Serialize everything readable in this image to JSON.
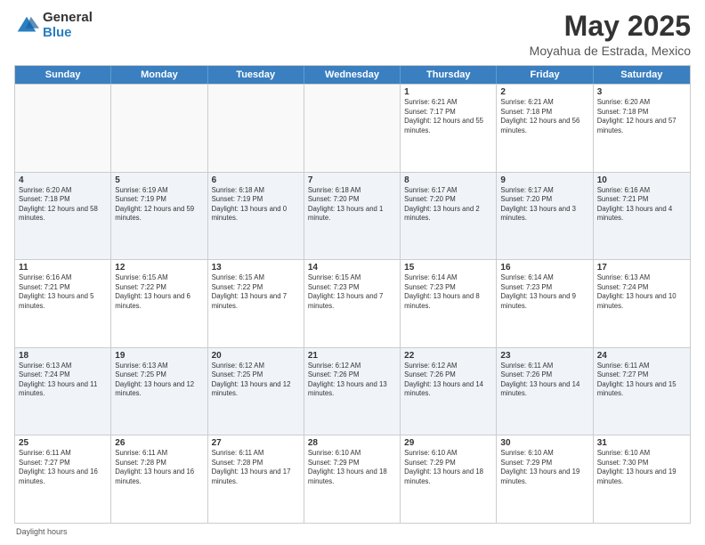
{
  "logo": {
    "general": "General",
    "blue": "Blue"
  },
  "title": "May 2025",
  "subtitle": "Moyahua de Estrada, Mexico",
  "header_days": [
    "Sunday",
    "Monday",
    "Tuesday",
    "Wednesday",
    "Thursday",
    "Friday",
    "Saturday"
  ],
  "weeks": [
    [
      {
        "day": "",
        "sunrise": "",
        "sunset": "",
        "daylight": ""
      },
      {
        "day": "",
        "sunrise": "",
        "sunset": "",
        "daylight": ""
      },
      {
        "day": "",
        "sunrise": "",
        "sunset": "",
        "daylight": ""
      },
      {
        "day": "",
        "sunrise": "",
        "sunset": "",
        "daylight": ""
      },
      {
        "day": "1",
        "sunrise": "Sunrise: 6:21 AM",
        "sunset": "Sunset: 7:17 PM",
        "daylight": "Daylight: 12 hours and 55 minutes."
      },
      {
        "day": "2",
        "sunrise": "Sunrise: 6:21 AM",
        "sunset": "Sunset: 7:18 PM",
        "daylight": "Daylight: 12 hours and 56 minutes."
      },
      {
        "day": "3",
        "sunrise": "Sunrise: 6:20 AM",
        "sunset": "Sunset: 7:18 PM",
        "daylight": "Daylight: 12 hours and 57 minutes."
      }
    ],
    [
      {
        "day": "4",
        "sunrise": "Sunrise: 6:20 AM",
        "sunset": "Sunset: 7:18 PM",
        "daylight": "Daylight: 12 hours and 58 minutes."
      },
      {
        "day": "5",
        "sunrise": "Sunrise: 6:19 AM",
        "sunset": "Sunset: 7:19 PM",
        "daylight": "Daylight: 12 hours and 59 minutes."
      },
      {
        "day": "6",
        "sunrise": "Sunrise: 6:18 AM",
        "sunset": "Sunset: 7:19 PM",
        "daylight": "Daylight: 13 hours and 0 minutes."
      },
      {
        "day": "7",
        "sunrise": "Sunrise: 6:18 AM",
        "sunset": "Sunset: 7:20 PM",
        "daylight": "Daylight: 13 hours and 1 minute."
      },
      {
        "day": "8",
        "sunrise": "Sunrise: 6:17 AM",
        "sunset": "Sunset: 7:20 PM",
        "daylight": "Daylight: 13 hours and 2 minutes."
      },
      {
        "day": "9",
        "sunrise": "Sunrise: 6:17 AM",
        "sunset": "Sunset: 7:20 PM",
        "daylight": "Daylight: 13 hours and 3 minutes."
      },
      {
        "day": "10",
        "sunrise": "Sunrise: 6:16 AM",
        "sunset": "Sunset: 7:21 PM",
        "daylight": "Daylight: 13 hours and 4 minutes."
      }
    ],
    [
      {
        "day": "11",
        "sunrise": "Sunrise: 6:16 AM",
        "sunset": "Sunset: 7:21 PM",
        "daylight": "Daylight: 13 hours and 5 minutes."
      },
      {
        "day": "12",
        "sunrise": "Sunrise: 6:15 AM",
        "sunset": "Sunset: 7:22 PM",
        "daylight": "Daylight: 13 hours and 6 minutes."
      },
      {
        "day": "13",
        "sunrise": "Sunrise: 6:15 AM",
        "sunset": "Sunset: 7:22 PM",
        "daylight": "Daylight: 13 hours and 7 minutes."
      },
      {
        "day": "14",
        "sunrise": "Sunrise: 6:15 AM",
        "sunset": "Sunset: 7:23 PM",
        "daylight": "Daylight: 13 hours and 7 minutes."
      },
      {
        "day": "15",
        "sunrise": "Sunrise: 6:14 AM",
        "sunset": "Sunset: 7:23 PM",
        "daylight": "Daylight: 13 hours and 8 minutes."
      },
      {
        "day": "16",
        "sunrise": "Sunrise: 6:14 AM",
        "sunset": "Sunset: 7:23 PM",
        "daylight": "Daylight: 13 hours and 9 minutes."
      },
      {
        "day": "17",
        "sunrise": "Sunrise: 6:13 AM",
        "sunset": "Sunset: 7:24 PM",
        "daylight": "Daylight: 13 hours and 10 minutes."
      }
    ],
    [
      {
        "day": "18",
        "sunrise": "Sunrise: 6:13 AM",
        "sunset": "Sunset: 7:24 PM",
        "daylight": "Daylight: 13 hours and 11 minutes."
      },
      {
        "day": "19",
        "sunrise": "Sunrise: 6:13 AM",
        "sunset": "Sunset: 7:25 PM",
        "daylight": "Daylight: 13 hours and 12 minutes."
      },
      {
        "day": "20",
        "sunrise": "Sunrise: 6:12 AM",
        "sunset": "Sunset: 7:25 PM",
        "daylight": "Daylight: 13 hours and 12 minutes."
      },
      {
        "day": "21",
        "sunrise": "Sunrise: 6:12 AM",
        "sunset": "Sunset: 7:26 PM",
        "daylight": "Daylight: 13 hours and 13 minutes."
      },
      {
        "day": "22",
        "sunrise": "Sunrise: 6:12 AM",
        "sunset": "Sunset: 7:26 PM",
        "daylight": "Daylight: 13 hours and 14 minutes."
      },
      {
        "day": "23",
        "sunrise": "Sunrise: 6:11 AM",
        "sunset": "Sunset: 7:26 PM",
        "daylight": "Daylight: 13 hours and 14 minutes."
      },
      {
        "day": "24",
        "sunrise": "Sunrise: 6:11 AM",
        "sunset": "Sunset: 7:27 PM",
        "daylight": "Daylight: 13 hours and 15 minutes."
      }
    ],
    [
      {
        "day": "25",
        "sunrise": "Sunrise: 6:11 AM",
        "sunset": "Sunset: 7:27 PM",
        "daylight": "Daylight: 13 hours and 16 minutes."
      },
      {
        "day": "26",
        "sunrise": "Sunrise: 6:11 AM",
        "sunset": "Sunset: 7:28 PM",
        "daylight": "Daylight: 13 hours and 16 minutes."
      },
      {
        "day": "27",
        "sunrise": "Sunrise: 6:11 AM",
        "sunset": "Sunset: 7:28 PM",
        "daylight": "Daylight: 13 hours and 17 minutes."
      },
      {
        "day": "28",
        "sunrise": "Sunrise: 6:10 AM",
        "sunset": "Sunset: 7:29 PM",
        "daylight": "Daylight: 13 hours and 18 minutes."
      },
      {
        "day": "29",
        "sunrise": "Sunrise: 6:10 AM",
        "sunset": "Sunset: 7:29 PM",
        "daylight": "Daylight: 13 hours and 18 minutes."
      },
      {
        "day": "30",
        "sunrise": "Sunrise: 6:10 AM",
        "sunset": "Sunset: 7:29 PM",
        "daylight": "Daylight: 13 hours and 19 minutes."
      },
      {
        "day": "31",
        "sunrise": "Sunrise: 6:10 AM",
        "sunset": "Sunset: 7:30 PM",
        "daylight": "Daylight: 13 hours and 19 minutes."
      }
    ]
  ],
  "footer": "Daylight hours"
}
